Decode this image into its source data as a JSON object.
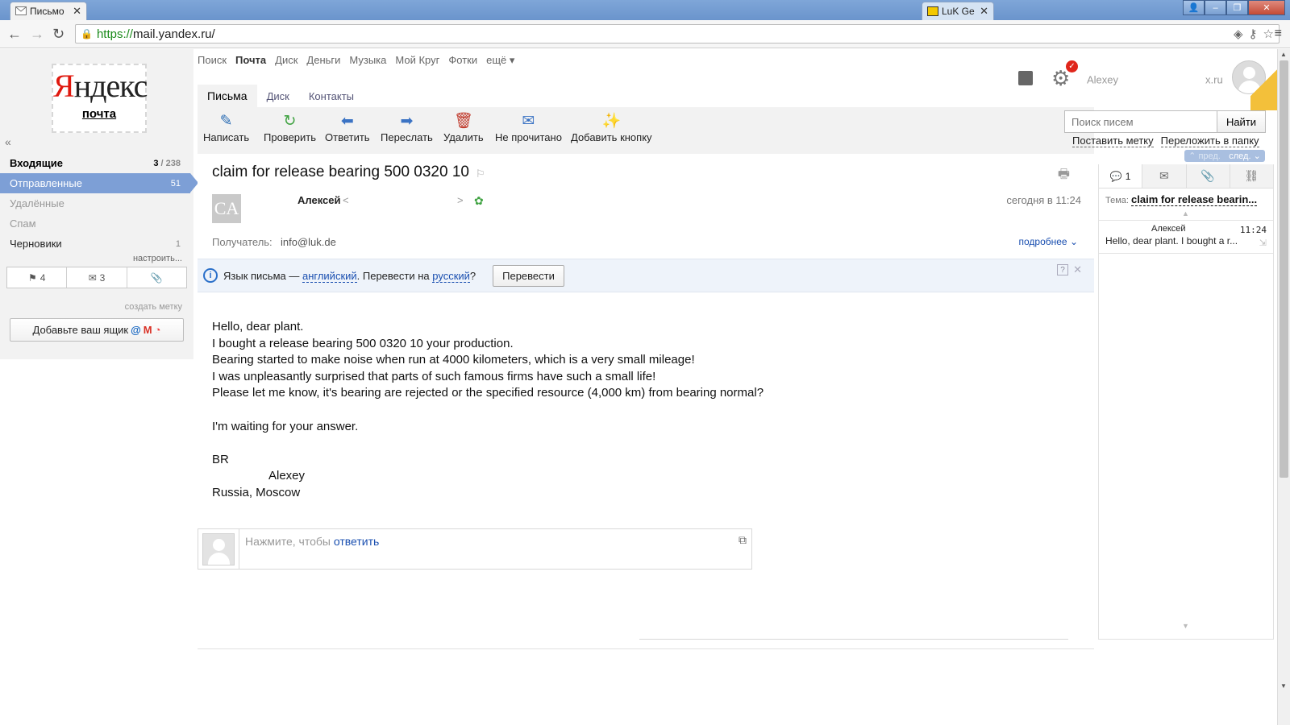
{
  "browser": {
    "tabs": [
      {
        "title": "Письмо",
        "active": true
      },
      {
        "title": "LuK Ge",
        "active": false
      }
    ],
    "url_scheme": "https://",
    "url_rest": "mail.yandex.ru/"
  },
  "logo": {
    "brand_first": "Я",
    "brand_rest": "ндекс",
    "service": "почта"
  },
  "services": [
    "Поиск",
    "Почта",
    "Диск",
    "Деньги",
    "Музыка",
    "Мой Круг",
    "Фотки",
    "ещё ▾"
  ],
  "subtabs": [
    "Письма",
    "Диск",
    "Контакты"
  ],
  "actions": {
    "compose": "Написать",
    "check": "Проверить",
    "reply": "Ответить",
    "forward": "Переслать",
    "delete": "Удалить",
    "unread": "Не прочитано",
    "add_button": "Добавить кнопку"
  },
  "folders": {
    "inbox": {
      "label": "Входящие",
      "unread": "3",
      "total": " / 238"
    },
    "sent": {
      "label": "Отправленные",
      "count": "51"
    },
    "trash": {
      "label": "Удалённые"
    },
    "spam": {
      "label": "Спам"
    },
    "drafts": {
      "label": "Черновики",
      "count": "1"
    }
  },
  "setup_link": "настроить...",
  "filters": {
    "flagged": "4",
    "unread": "3"
  },
  "create_label": "создать метку",
  "add_mailbox": "Добавьте ваш ящик",
  "user": {
    "email_start": "Alexey",
    "email_end": "x.ru"
  },
  "search": {
    "placeholder": "Поиск писем",
    "button": "Найти"
  },
  "label_links": {
    "set_label": "Поставить метку",
    "move_to_folder": "Переложить в папку"
  },
  "prevnext": {
    "prev": "пред.",
    "next": "след."
  },
  "message": {
    "subject": "claim for release bearing 500 0320 10",
    "sender_avatar": "CA",
    "sender_name": "Алексей",
    "date": "сегодня в 11:24",
    "recipient_label": "Получатель:",
    "recipient": "info@luk.de",
    "more": "подробнее",
    "body": [
      "Hello, dear plant.",
      "I bought a release bearing 500 0320 10 your production.",
      "Bearing started to make noise when run at 4000 kilometers, which is a very small mileage!",
      "I was unpleasantly surprised that parts of such famous firms have such a small life!",
      "Please let me know, it's bearing are rejected or the specified resource (4,000 km) from bearing normal?",
      "",
      "I'm waiting for your answer.",
      "",
      "BR",
      "Alexey",
      "Russia, Moscow"
    ]
  },
  "translate": {
    "prefix": "Язык письма — ",
    "source_lang": "английский",
    "middle": ". Перевести на ",
    "target_lang": "русский",
    "suffix": "?",
    "button": "Перевести"
  },
  "reply": {
    "hint": "Нажмите, чтобы ",
    "link": "ответить"
  },
  "thread": {
    "count": "1",
    "topic_label": "Тема:",
    "topic": "claim for release bearin...",
    "item": {
      "name": "Алексей",
      "time": "11:24",
      "snippet": "Hello, dear plant. I bought a r..."
    }
  },
  "colors": {
    "accent_blue": "#7d9fd6",
    "yandex_red": "#e0180e",
    "link": "#1a4fb0"
  }
}
